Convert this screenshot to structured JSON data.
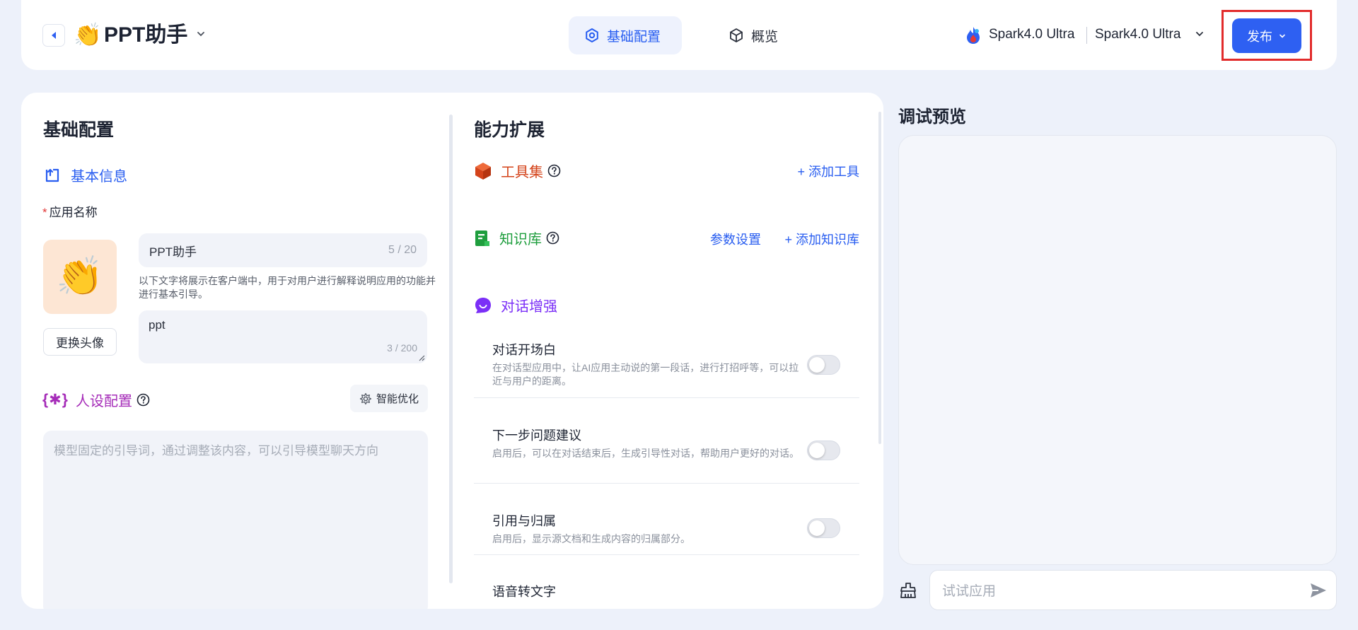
{
  "header": {
    "app_emoji": "👏",
    "app_title": "PPT助手",
    "tabs": [
      {
        "label": "基础配置",
        "icon": "gear-icon",
        "active": true
      },
      {
        "label": "概览",
        "icon": "cube-icon",
        "active": false
      }
    ],
    "model_primary": "Spark4.0 Ultra",
    "model_secondary": "Spark4.0 Ultra",
    "publish_label": "发布"
  },
  "basic": {
    "section_title": "基础配置",
    "basic_info_label": "基本信息",
    "app_name_label": "应用名称",
    "required_mark": "*",
    "avatar_emoji": "👏",
    "change_avatar_label": "更换头像",
    "name_value": "PPT助手",
    "name_count": "5 / 20",
    "helper_text": "以下文字将展示在客户端中，用于对用户进行解释说明应用的功能并进行基本引导。",
    "desc_value": "ppt",
    "desc_count": "3 / 200",
    "persona_label": "人设配置",
    "persona_brace": "{✱}",
    "smart_opt_label": "智能优化",
    "prompt_placeholder": "模型固定的引导词，通过调整该内容，可以引导模型聊天方向"
  },
  "ability": {
    "section_title": "能力扩展",
    "tools_label": "工具集",
    "add_tool": "+ 添加工具",
    "kb_label": "知识库",
    "param_settings": "参数设置",
    "add_kb": "+ 添加知识库",
    "chat_enhance_label": "对话增强",
    "features": [
      {
        "title": "对话开场白",
        "desc": "在对话型应用中，让AI应用主动说的第一段话，进行打招呼等，可以拉近与用户的距离。",
        "enabled": false
      },
      {
        "title": "下一步问题建议",
        "desc": "启用后，可以在对话结束后，生成引导性对话，帮助用户更好的对话。",
        "enabled": false
      },
      {
        "title": "引用与归属",
        "desc": "启用后，显示源文档和生成内容的归属部分。",
        "enabled": false
      },
      {
        "title": "语音转文字",
        "desc": "",
        "enabled": false
      }
    ]
  },
  "preview": {
    "title": "调试预览",
    "input_placeholder": "试试应用"
  },
  "colors": {
    "accent": "#2e60f2",
    "tools": "#d4431a",
    "knowledge": "#1f9e3e",
    "chat": "#7b2ff7",
    "persona": "#a52bb8",
    "highlight": "#e22b2b"
  }
}
